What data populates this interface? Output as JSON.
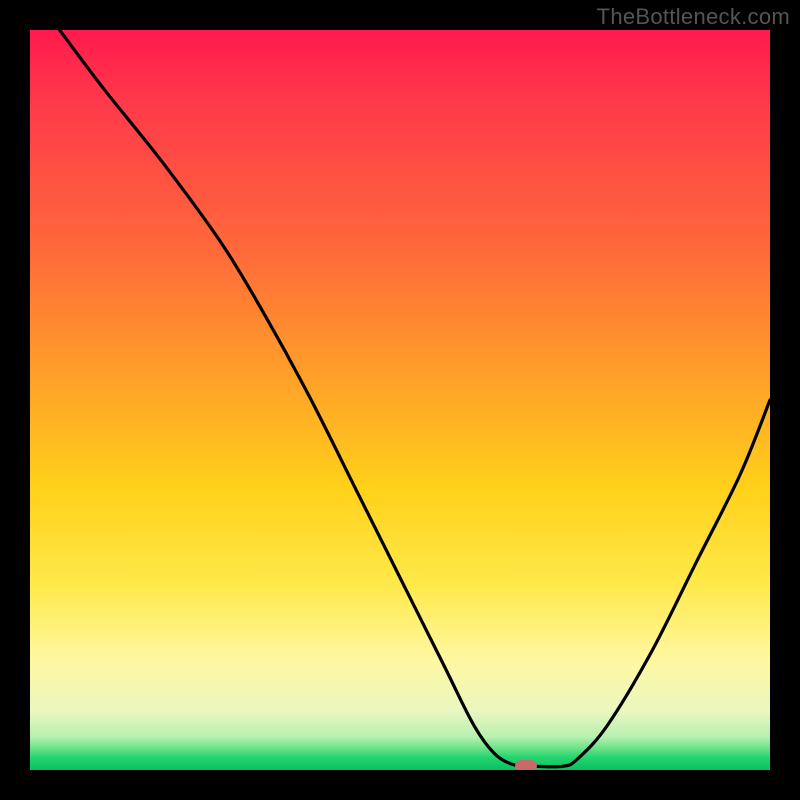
{
  "watermark": "TheBottleneck.com",
  "chart_data": {
    "type": "line",
    "title": "",
    "xlabel": "",
    "ylabel": "",
    "xlim": [
      0,
      100
    ],
    "ylim": [
      0,
      100
    ],
    "grid": false,
    "legend": false,
    "series": [
      {
        "name": "bottleneck-curve",
        "x": [
          4,
          10,
          18,
          26,
          32,
          38,
          44,
          50,
          56,
          60,
          63,
          66,
          68,
          72,
          74,
          78,
          84,
          90,
          96,
          100
        ],
        "y": [
          100,
          92,
          82,
          71,
          61,
          50,
          38,
          26,
          14,
          6,
          2,
          0.5,
          0.5,
          0.5,
          1.5,
          6,
          16,
          28,
          40,
          50
        ]
      }
    ],
    "marker": {
      "x": 67,
      "y": 0.5
    },
    "background": "heatmap-gradient-red-to-green"
  },
  "colors": {
    "curve": "#000000",
    "marker": "#c86a6a",
    "frame": "#000000"
  }
}
